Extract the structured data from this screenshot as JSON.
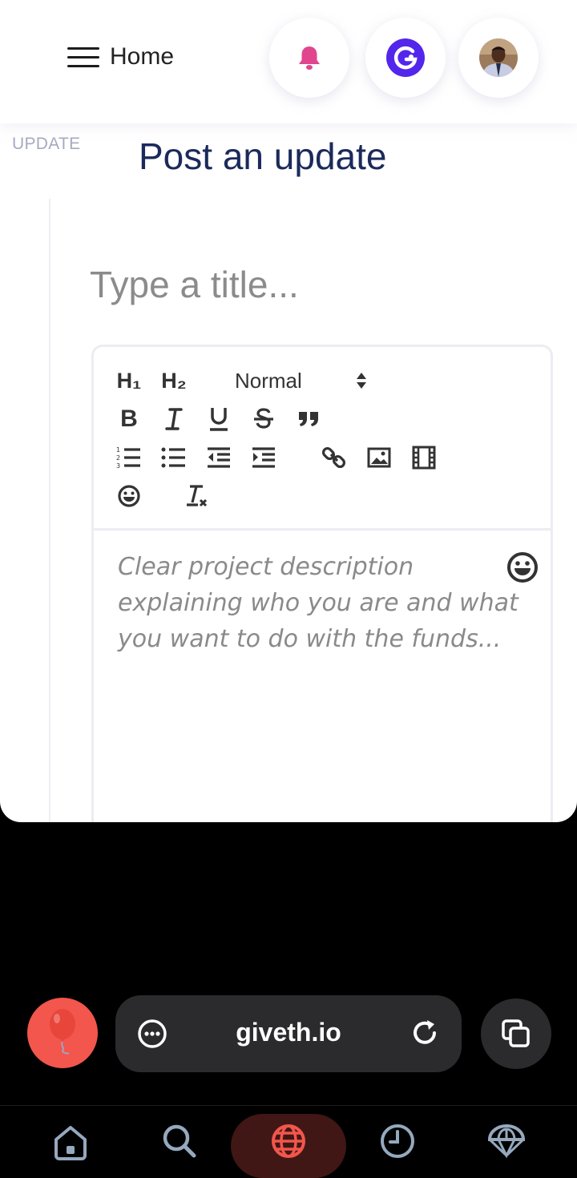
{
  "header": {
    "menu_label": "Home",
    "notification_icon": "bell-icon",
    "wallet_icon": "giveth-logo-icon",
    "avatar": "user-avatar"
  },
  "page": {
    "section_label": "UPDATE",
    "title": "Post an update",
    "title_placeholder": "Type a title..."
  },
  "editor": {
    "toolbar": {
      "h1": "H₁",
      "h2": "H₂",
      "format_select": "Normal",
      "buttons": [
        "bold",
        "italic",
        "underline",
        "strike",
        "blockquote",
        "ordered-list",
        "bullet-list",
        "outdent",
        "indent",
        "link",
        "image",
        "video",
        "emoji",
        "clear-format"
      ]
    },
    "placeholder": "Clear project description explaining who you are and what you want to do with the funds..."
  },
  "browser": {
    "url": "giveth.io",
    "menu_icon": "more-icon",
    "reload_icon": "reload-icon",
    "tabs_icon": "tabs-icon",
    "balloon_icon": "balloon-icon"
  },
  "bottom_nav": {
    "items": [
      "home-icon",
      "search-icon",
      "globe-icon",
      "history-icon",
      "parachute-icon"
    ],
    "active": "globe-icon"
  },
  "colors": {
    "accent_pink": "#e1458d",
    "giveth_purple": "#5326ec",
    "title_navy": "#1b2a5b",
    "balloon_red": "#f2564c"
  }
}
